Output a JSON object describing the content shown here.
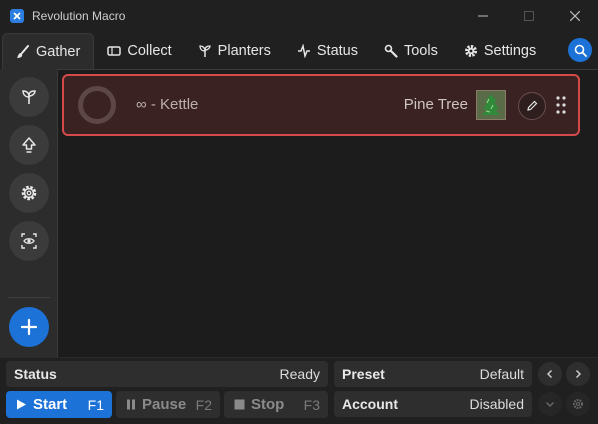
{
  "window": {
    "title": "Revolution Macro"
  },
  "tabs": [
    {
      "label": "Gather",
      "icon": "brush-icon",
      "active": true
    },
    {
      "label": "Collect",
      "icon": "ticket-icon"
    },
    {
      "label": "Planters",
      "icon": "sprout-icon"
    },
    {
      "label": "Status",
      "icon": "pulse-icon"
    },
    {
      "label": "Tools",
      "icon": "wrench-icon"
    },
    {
      "label": "Settings",
      "icon": "gear-icon"
    }
  ],
  "sidebar": {
    "buttons": [
      "sprout-icon",
      "arrow-up-icon",
      "gear-icon",
      "eye-scan-icon"
    ],
    "add_icon": "plus-icon"
  },
  "gather_list": [
    {
      "name": "∞ - Kettle",
      "field": "Pine Tree"
    }
  ],
  "status": {
    "label": "Status",
    "value": "Ready"
  },
  "preset": {
    "label": "Preset",
    "value": "Default"
  },
  "account": {
    "label": "Account",
    "value": "Disabled"
  },
  "controls": {
    "start": {
      "label": "Start",
      "key": "F1"
    },
    "pause": {
      "label": "Pause",
      "key": "F2"
    },
    "stop": {
      "label": "Stop",
      "key": "F3"
    }
  },
  "colors": {
    "accent": "#1d72d8",
    "card_border": "#d44a4a",
    "card_bg": "#3a2222"
  }
}
